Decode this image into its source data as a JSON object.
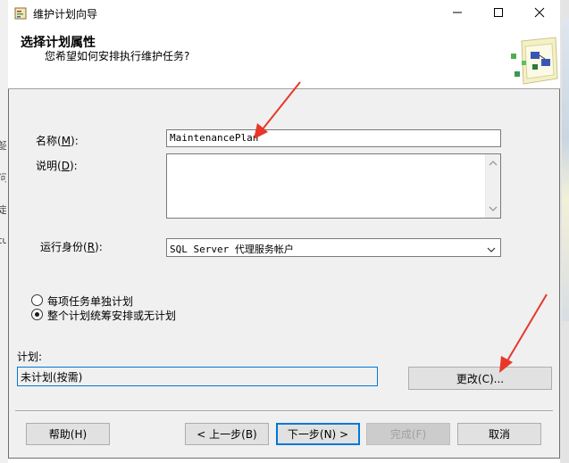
{
  "window": {
    "title": "维护计划向导"
  },
  "header": {
    "title": "选择计划属性",
    "subtitle": "您希望如何安排执行维护任务?"
  },
  "form": {
    "name_label": "名称(",
    "name_key": "M",
    "name_suffix": "):",
    "name_value": "MaintenancePlan",
    "desc_label": "说明(",
    "desc_key": "D",
    "desc_suffix": "):",
    "runas_label": "运行身份(",
    "runas_key": "R",
    "runas_suffix": "):",
    "runas_value": "SQL Server 代理服务帐户"
  },
  "schedule_options": {
    "option1": "每项任务单独计划",
    "option2": "整个计划统筹安排或无计划",
    "selected": 2
  },
  "plan": {
    "label": "计划:",
    "value": "未计划(按需)",
    "change_button": "更改(C)..."
  },
  "buttons": {
    "help": "帮助(H)",
    "back": "< 上一步(B)",
    "next": "下一步(N) >",
    "finish": "完成(F)",
    "cancel": "取消"
  },
  "background_chars": [
    "韶",
    "问",
    "定",
    "tu"
  ],
  "colors": {
    "focus_blue": "#0078d7",
    "arrow_red": "#e8372a"
  }
}
